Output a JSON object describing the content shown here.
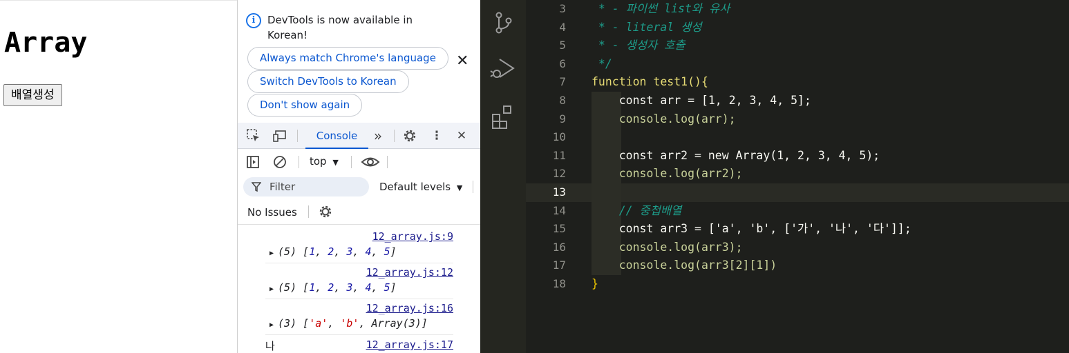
{
  "page": {
    "heading": "Array",
    "button_label": "배열생성"
  },
  "devtools": {
    "banner": {
      "message": "DevTools is now available in Korean!",
      "btn_match": "Always match Chrome's language",
      "btn_switch": "Switch DevTools to Korean",
      "btn_dont_show": "Don't show again",
      "close": "✕"
    },
    "tabs": {
      "console": "Console",
      "more": "»",
      "close": "✕"
    },
    "toolbar": {
      "context": "top",
      "filter_placeholder": "Filter",
      "levels": "Default levels"
    },
    "issues": {
      "label": "No Issues"
    },
    "log": [
      {
        "source": "12_array.js:9",
        "count": "(5)",
        "values": [
          "1",
          "2",
          "3",
          "4",
          "5"
        ]
      },
      {
        "source": "12_array.js:12",
        "count": "(5)",
        "values": [
          "1",
          "2",
          "3",
          "4",
          "5"
        ]
      },
      {
        "source": "12_array.js:16",
        "count": "(3)",
        "values": [
          "'a'",
          "'b'",
          "Array(3)"
        ]
      },
      {
        "source": "12_array.js:17",
        "text": "나"
      }
    ]
  },
  "editor": {
    "lines": [
      {
        "n": "3",
        "text": " * - 파이썬 list와 유사"
      },
      {
        "n": "4",
        "text": " * - literal 생성"
      },
      {
        "n": "5",
        "text": " * - 생성자 호출"
      },
      {
        "n": "6",
        "text": " */"
      },
      {
        "n": "7",
        "text": "function test1(){"
      },
      {
        "n": "8",
        "text": "    const arr = [1, 2, 3, 4, 5];"
      },
      {
        "n": "9",
        "text": "    console.log(arr);"
      },
      {
        "n": "10",
        "text": ""
      },
      {
        "n": "11",
        "text": "    const arr2 = new Array(1, 2, 3, 4, 5);"
      },
      {
        "n": "12",
        "text": "    console.log(arr2);"
      },
      {
        "n": "13",
        "text": ""
      },
      {
        "n": "14",
        "text": "    // 중첩배열"
      },
      {
        "n": "15",
        "text": "    const arr3 = ['a', 'b', ['가', '나', '다']];"
      },
      {
        "n": "16",
        "text": "    console.log(arr3);"
      },
      {
        "n": "17",
        "text": "    console.log(arr3[2][1])"
      },
      {
        "n": "18",
        "text": "}"
      }
    ],
    "current_line": "13"
  }
}
